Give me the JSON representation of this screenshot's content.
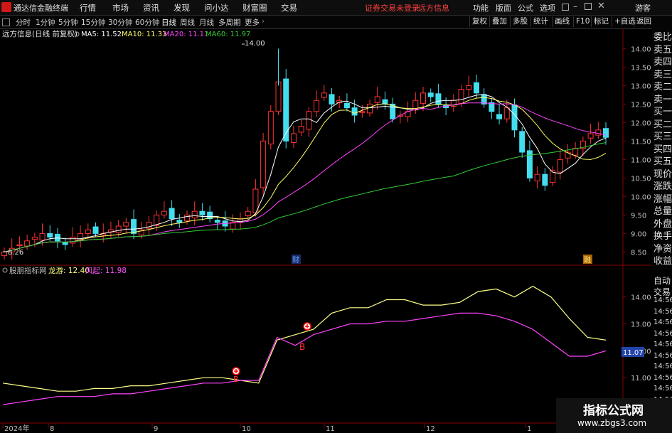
{
  "app": {
    "title": "通达信金融终端",
    "menus": [
      "行情",
      "市场",
      "资讯",
      "发现",
      "问小达",
      "财富圈",
      "交易"
    ],
    "status_warn": "证券交易未登录",
    "status_name": "远方信息",
    "right_menus": [
      "功能",
      "版面",
      "公式",
      "选项"
    ],
    "guest": "游客"
  },
  "toolbar": {
    "periods": [
      "分时",
      "1分钟",
      "5分钟",
      "15分钟",
      "30分钟",
      "60分钟",
      "日线",
      "周线",
      "月线",
      "多周期",
      "更多"
    ],
    "active_period": "日线",
    "right_buttons": [
      "复权",
      "叠加",
      "多股",
      "统计",
      "画线",
      "F10",
      "标记",
      "+自选",
      "返回"
    ]
  },
  "main_chart": {
    "header": "远方信息(日线 前复权)",
    "ma5": "MA5: 11.52",
    "ma10": "MA10: 11.33",
    "ma20": "MA20: 11.11",
    "ma60": "MA60: 11.97",
    "high_label": "14.00",
    "low_label": "8.26",
    "fin_marker": "财",
    "rongzi_marker": "融",
    "colors": {
      "ma5": "#ffffff",
      "ma10": "#ffff66",
      "ma20": "#ff44ff",
      "ma60": "#33cc33",
      "up": "#ff3333",
      "down": "#44ddee"
    }
  },
  "chart_data": [
    {
      "type": "candlestick",
      "title": "远方信息(日线 前复权)",
      "y_ticks": [
        "14.00",
        "13.50",
        "13.00",
        "12.50",
        "12.00",
        "11.50",
        "11.00",
        "10.50",
        "10.00",
        "9.50",
        "9.00",
        "8.50"
      ],
      "ylim": [
        8.2,
        14.2
      ],
      "x_ticks": [
        "2024年",
        "8",
        "9",
        "10",
        "11",
        "12",
        "1"
      ],
      "close_approx": [
        8.5,
        8.6,
        8.7,
        8.8,
        8.9,
        9.0,
        8.9,
        8.8,
        8.7,
        8.9,
        9.0,
        9.1,
        9.0,
        9.0,
        9.1,
        9.2,
        9.3,
        9.0,
        9.1,
        9.3,
        9.5,
        9.6,
        9.4,
        9.3,
        9.5,
        9.6,
        9.5,
        9.4,
        9.3,
        9.2,
        9.3,
        9.4,
        9.6,
        10.2,
        11.5,
        12.3,
        13.1,
        11.5,
        11.7,
        11.9,
        12.3,
        12.6,
        12.8,
        12.5,
        12.6,
        12.4,
        12.2,
        12.3,
        12.5,
        12.7,
        12.5,
        12.1,
        12.2,
        12.3,
        12.6,
        12.8,
        12.7,
        12.5,
        12.4,
        12.6,
        12.9,
        13.0,
        12.8,
        12.5,
        12.3,
        12.1,
        12.4,
        11.8,
        11.2,
        10.5,
        10.6,
        10.3,
        10.7,
        11.0,
        11.2,
        11.3,
        11.5,
        11.7,
        11.8,
        11.6
      ],
      "series": [
        {
          "name": "MA5",
          "last": "11.52"
        },
        {
          "name": "MA10",
          "last": "11.33"
        },
        {
          "name": "MA20",
          "last": "11.11"
        },
        {
          "name": "MA60",
          "last": "11.97"
        }
      ]
    },
    {
      "type": "line",
      "title": "股朋指标网",
      "y_ticks": [
        "14.00",
        "13.00",
        "12.00",
        "11.00",
        "10.00"
      ],
      "ylim": [
        9.5,
        14.6
      ],
      "current_value_box": "11.07",
      "series": [
        {
          "name": "龙游",
          "last": "12.40",
          "values": [
            10.8,
            10.7,
            10.6,
            10.5,
            10.5,
            10.6,
            10.6,
            10.7,
            10.7,
            10.8,
            10.9,
            11.0,
            11.0,
            10.9,
            10.8,
            12.4,
            12.6,
            12.8,
            13.4,
            13.6,
            13.6,
            13.9,
            13.9,
            13.7,
            13.7,
            13.8,
            14.2,
            14.3,
            14.0,
            14.4,
            14.0,
            13.2,
            12.5,
            12.4
          ]
        },
        {
          "name": "风起",
          "last": "11.98",
          "values": [
            10.0,
            10.1,
            10.2,
            10.3,
            10.3,
            10.3,
            10.4,
            10.4,
            10.5,
            10.6,
            10.7,
            10.8,
            10.8,
            10.9,
            10.9,
            12.5,
            12.2,
            12.6,
            12.8,
            13.0,
            13.0,
            13.1,
            13.1,
            13.2,
            13.3,
            13.4,
            13.4,
            13.3,
            13.1,
            12.8,
            12.3,
            11.8,
            11.8,
            12.0
          ]
        }
      ],
      "signals": [
        "B",
        "B"
      ]
    }
  ],
  "indicator": {
    "header": "股朋指标网",
    "series1_label": "龙游: 12.40",
    "series2_label": "风起: 11.98",
    "buy_label": "B",
    "box_value": "11.07"
  },
  "side_panel": [
    "委比",
    "卖五",
    "卖四",
    "卖三",
    "卖二",
    "卖一",
    "买一",
    "买二",
    "买三",
    "买四",
    "买五",
    "现价",
    "涨跌",
    "涨幅",
    "总量",
    "外盘",
    "换手",
    "净资",
    "收益"
  ],
  "side_panel_lower": [
    "自动",
    "交易",
    "14:56",
    "14:56",
    "14:56",
    "14:56",
    "14:56",
    "14:56",
    "14:56",
    "14:56",
    "14:56",
    "14:56",
    "14:56"
  ],
  "watermark": {
    "title": "指标公式网",
    "url": "www.zbgs3.com"
  }
}
